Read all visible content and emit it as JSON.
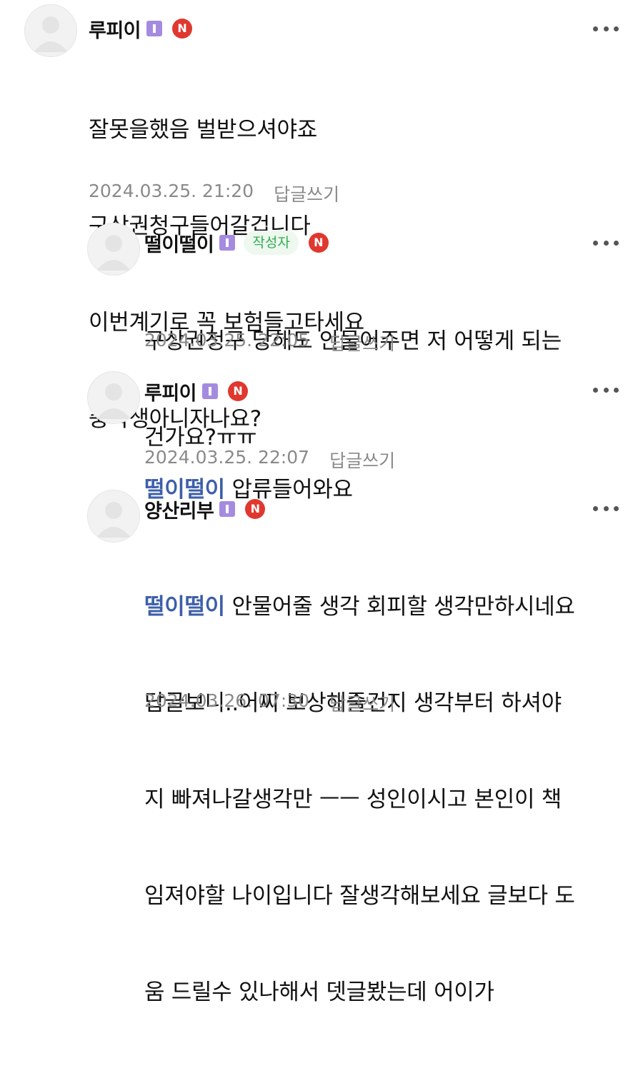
{
  "comments": [
    {
      "nickname": "루피이",
      "level_badge": "level-1-badge",
      "author_badge": "",
      "n_badge": "N",
      "mention": "",
      "lines": [
        "잘못을했음 벌받으셔야죠",
        "구상권청구들어갈겁니다",
        "이번계기로 꼭 보험들고타세요",
        "중학생아니자나요?"
      ],
      "timestamp": "2024.03.25. 21:20",
      "reply_label": "답글쓰기"
    },
    {
      "nickname": "떨이떨이",
      "level_badge": "level-1-badge",
      "author_badge": "작성자",
      "n_badge": "N",
      "mention": "",
      "lines": [
        "구상권청구 당해도 안물어주면 저 어떻게 되는",
        "건가요?ㅠㅠ"
      ],
      "timestamp": "2024.03.25. 22:05",
      "reply_label": "답글쓰기"
    },
    {
      "nickname": "루피이",
      "level_badge": "level-1-badge",
      "author_badge": "",
      "n_badge": "N",
      "mention": "떨이떨이",
      "lines": [
        "압류들어와요"
      ],
      "timestamp": "2024.03.25. 22:07",
      "reply_label": "답글쓰기"
    },
    {
      "nickname": "양산리부",
      "level_badge": "level-1-badge",
      "author_badge": "",
      "n_badge": "N",
      "mention": "떨이떨이",
      "lines": [
        "안물어줄 생각 회피할 생각만하시네요",
        "답글보니..어찌 보상해줄건지 생각부터 하셔야",
        "지 빠져나갈생각만 ㅡㅡ 성인이시고 본인이 책",
        "임져야할 나이입니다 잘생각해보세요 글보다 도",
        "움 드릴수 있나해서 뎃글봤는데 어이가"
      ],
      "timestamp": "2024.03.26. 07:30",
      "reply_label": "답글쓰기"
    }
  ],
  "icons": {
    "avatar": "default-profile-icon",
    "more": "more-options-icon",
    "new": "new-n-badge"
  },
  "colors": {
    "mention": "#3d5faa",
    "author_badge_text": "#2fae52",
    "n_badge": "#e0372f",
    "level_badge": "#a58be0",
    "meta": "#8a8a8a"
  }
}
